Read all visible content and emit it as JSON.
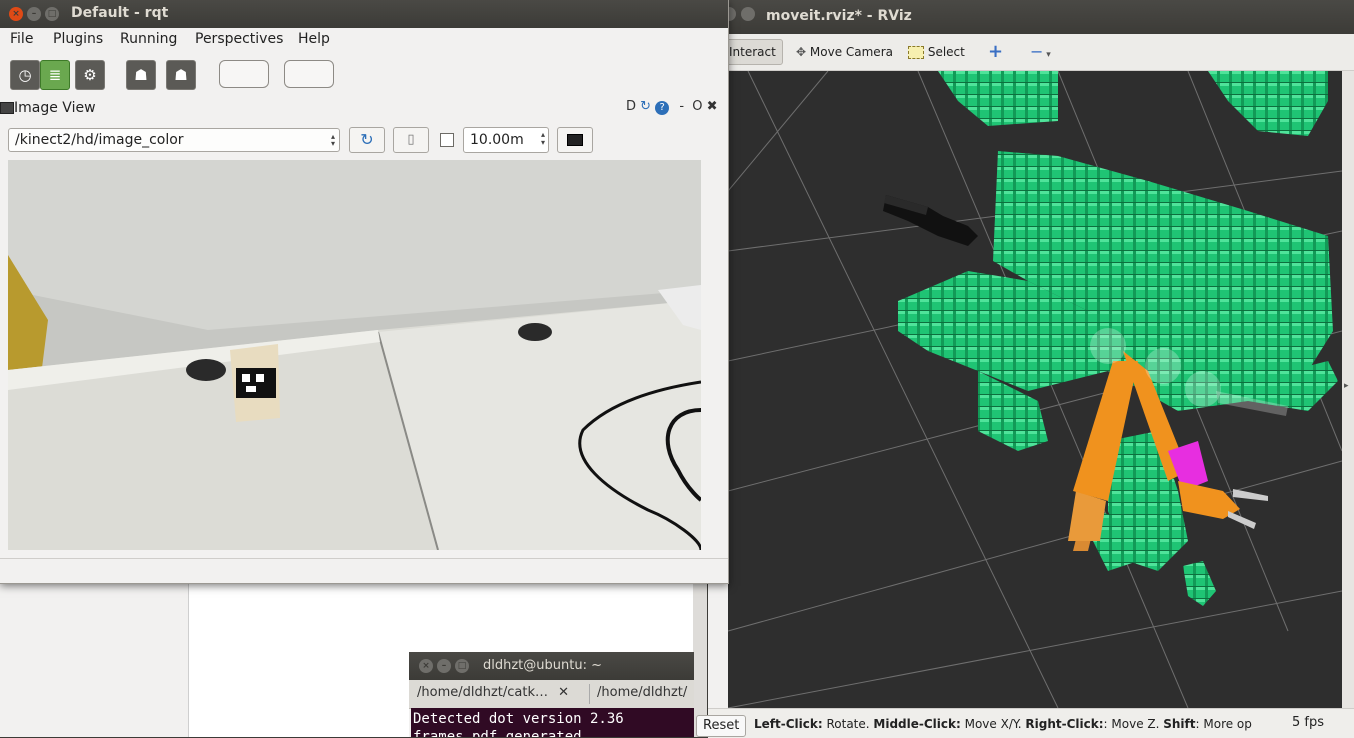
{
  "rviz": {
    "title": "moveit.rviz* - RViz",
    "tools": [
      {
        "label": "Interact"
      },
      {
        "label": "Move Camera"
      },
      {
        "label": "Select"
      }
    ],
    "status": {
      "reset_label": "Reset",
      "segments": [
        {
          "key": "Left-Click:",
          "text": " Rotate. "
        },
        {
          "key": "Middle-Click:",
          "text": " Move X/Y. "
        },
        {
          "key": "Right-Click:",
          "text": ": Move Z. "
        },
        {
          "key": "Shift",
          "text": ": More op"
        }
      ],
      "fps": "5 fps"
    },
    "colors": {
      "background": "#2e2e2e",
      "voxel": "#1fc474",
      "arm": "#f0921e",
      "gripper_link": "#e72ee0"
    }
  },
  "terminal": {
    "title": "dldhzt@ubuntu: ~",
    "tabs": [
      {
        "label": "/home/dldhzt/catk…"
      },
      {
        "label": "/home/dldhzt/"
      }
    ],
    "lines": [
      "Detected dot version 2.36",
      "frames.pdf generated"
    ]
  },
  "rqt": {
    "title": "Default - rqt",
    "menus": [
      "File",
      "Plugins",
      "Running",
      "Perspectives",
      "Help"
    ],
    "image_view": {
      "title": "Image View",
      "controls": "D",
      "close_label": "O",
      "topic": "/kinect2/hd/image_color",
      "distance": "10.00m"
    }
  }
}
